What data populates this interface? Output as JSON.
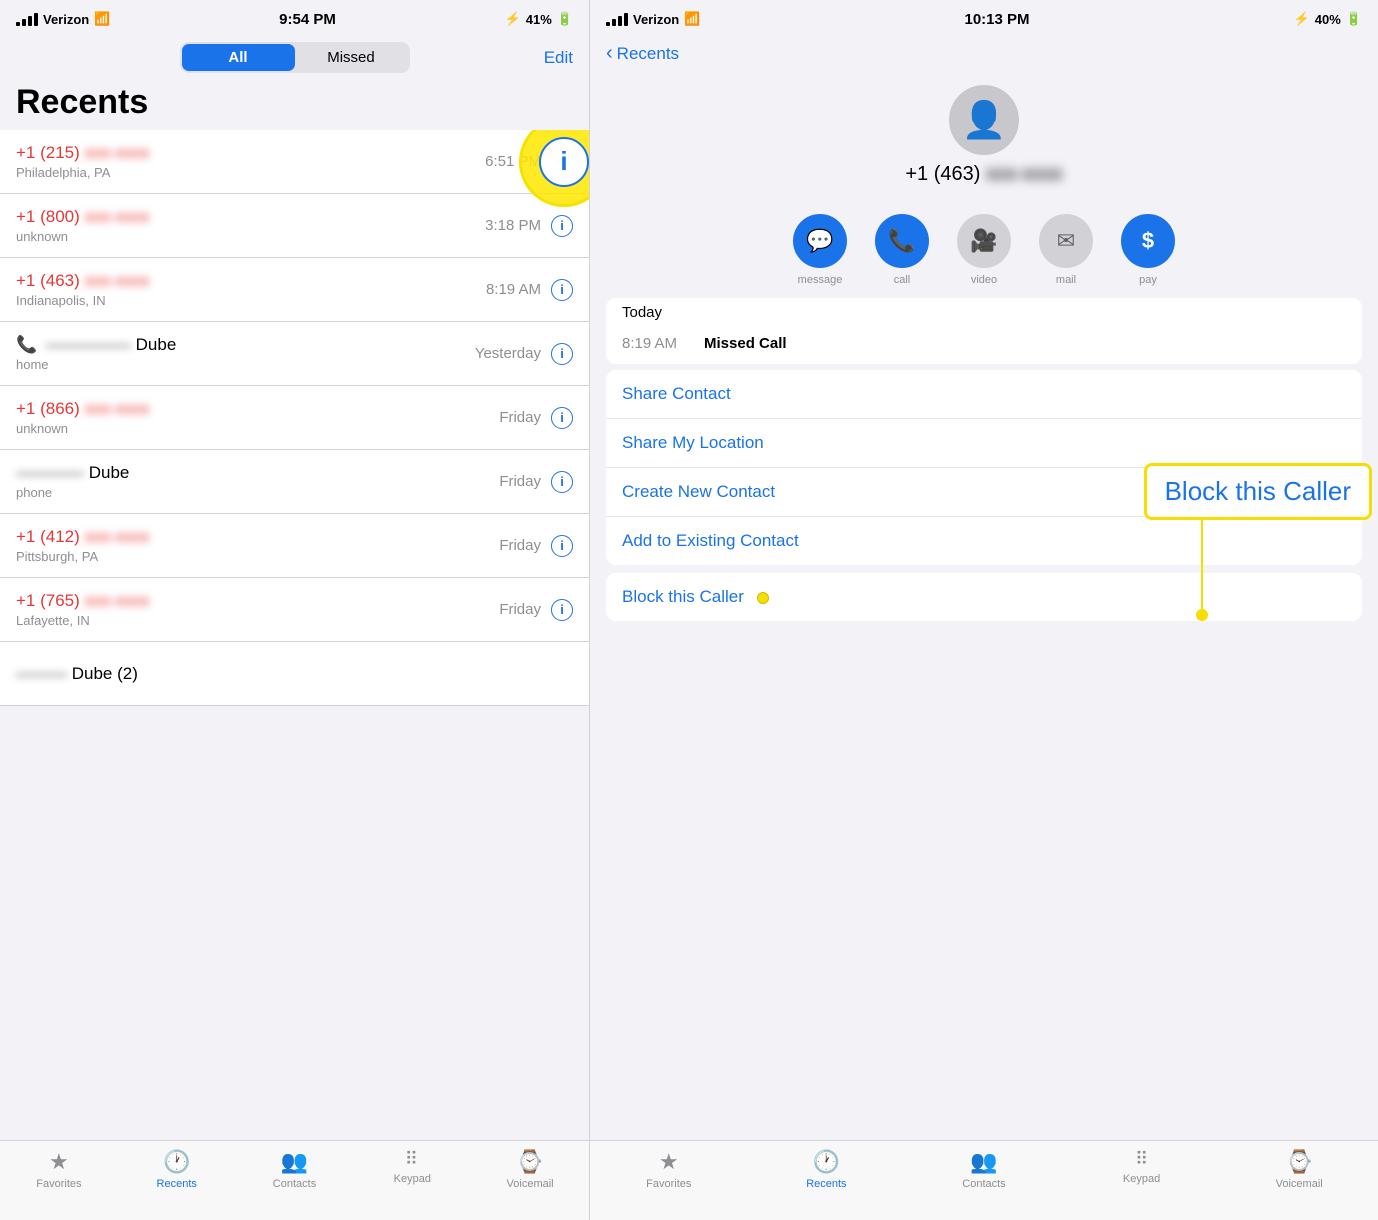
{
  "left": {
    "status_bar": {
      "carrier": "Verizon",
      "wifi": "wifi",
      "time": "9:54 PM",
      "bluetooth": "BT",
      "battery": "41%"
    },
    "segment": {
      "all_label": "All",
      "missed_label": "Missed",
      "edit_label": "Edit"
    },
    "title": "Recents",
    "calls": [
      {
        "number": "+1 (215)",
        "blurred": "xxx-xxxx",
        "subtitle": "Philadelphia, PA",
        "time": "6:51 PM",
        "missed": false
      },
      {
        "number": "+1 (800)",
        "blurred": "xxx-xxxx",
        "subtitle": "unknown",
        "time": "3:18 PM",
        "missed": false
      },
      {
        "number": "+1 (463)",
        "blurred": "xxx-xxxx",
        "subtitle": "Indianapolis, IN",
        "time": "8:19 AM",
        "missed": false
      },
      {
        "name_blurred": "——————",
        "name_suffix": " Dube",
        "subtitle": "home",
        "time": "Yesterday",
        "missed": true
      },
      {
        "number": "+1 (866)",
        "blurred": "xxx-xxxx",
        "subtitle": "unknown",
        "time": "Friday",
        "missed": false
      },
      {
        "name_blurred": "—————",
        "name_suffix": " Dube",
        "subtitle": "phone",
        "time": "Friday",
        "missed": false
      },
      {
        "number": "+1 (412)",
        "blurred": "xxx-xxxx",
        "subtitle": "Pittsburgh, PA",
        "time": "Friday",
        "missed": false
      },
      {
        "number": "+1 (765)",
        "blurred": "xxx-xxxx",
        "subtitle": "Lafayette, IN",
        "time": "Friday",
        "missed": false
      },
      {
        "name_blurred": "——— Dube (2)",
        "subtitle": "",
        "time": "",
        "missed": false,
        "partial": true
      }
    ],
    "tab_bar": {
      "items": [
        {
          "icon": "★",
          "label": "Favorites",
          "active": false
        },
        {
          "icon": "🕐",
          "label": "Recents",
          "active": true
        },
        {
          "icon": "👥",
          "label": "Contacts",
          "active": false
        },
        {
          "icon": "⠿",
          "label": "Keypad",
          "active": false
        },
        {
          "icon": "⌁",
          "label": "Voicemail",
          "active": false
        }
      ]
    }
  },
  "right": {
    "status_bar": {
      "carrier": "Verizon",
      "wifi": "wifi",
      "time": "10:13 PM",
      "bluetooth": "BT",
      "battery": "40%"
    },
    "nav": {
      "back_label": "Recents"
    },
    "contact": {
      "number_prefix": "+1 (463)",
      "number_blurred": "xxx-xxxx"
    },
    "actions": [
      {
        "icon": "💬",
        "label": "message",
        "style": "blue"
      },
      {
        "icon": "📞",
        "label": "call",
        "style": "blue"
      },
      {
        "icon": "🎥",
        "label": "video",
        "style": "gray"
      },
      {
        "icon": "✉",
        "label": "mail",
        "style": "gray"
      },
      {
        "icon": "$",
        "label": "pay",
        "style": "dollar"
      }
    ],
    "call_history": {
      "date_label": "Today",
      "time": "8:19 AM",
      "call_type": "Missed Call"
    },
    "menu_items": [
      {
        "label": "Share Contact",
        "color": "blue"
      },
      {
        "label": "Share My Location",
        "color": "blue"
      },
      {
        "label": "Create New Contact",
        "color": "blue"
      },
      {
        "label": "Add to Existing Contact",
        "color": "blue"
      },
      {
        "label": "Block this Caller",
        "color": "blue"
      }
    ],
    "highlight_box": {
      "text": "Block this Caller"
    },
    "tab_bar": {
      "items": [
        {
          "icon": "★",
          "label": "Favorites",
          "active": false
        },
        {
          "icon": "🕐",
          "label": "Recents",
          "active": true
        },
        {
          "icon": "👥",
          "label": "Contacts",
          "active": false
        },
        {
          "icon": "⠿",
          "label": "Keypad",
          "active": false
        },
        {
          "icon": "⌁",
          "label": "Voicemail",
          "active": false
        }
      ]
    }
  }
}
